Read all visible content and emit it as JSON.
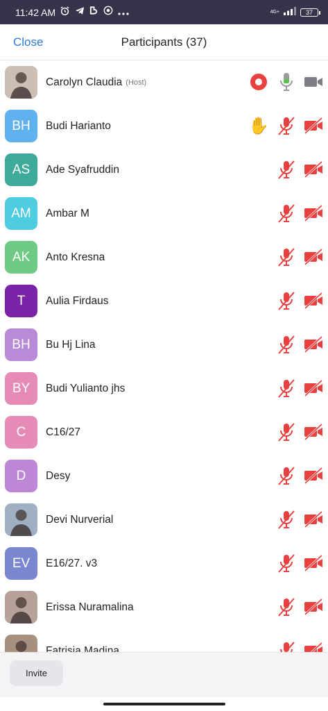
{
  "status_bar": {
    "time": "11:42 AM",
    "network": "4G+",
    "battery": "37",
    "icons": [
      "alarm-icon",
      "telegram-icon",
      "app-icon",
      "chrome-icon",
      "more-icon"
    ]
  },
  "header": {
    "close_label": "Close",
    "title": "Participants (37)"
  },
  "participants": [
    {
      "name": "Carolyn Claudia",
      "tag": "(Host)",
      "initials": "",
      "avatar_color": "#cdbfb4",
      "photo": true,
      "hand_raised": false,
      "recording": true,
      "mic_muted": false,
      "cam_off": true
    },
    {
      "name": "Budi Harianto",
      "tag": "",
      "initials": "BH",
      "avatar_color": "#5fb2ee",
      "photo": false,
      "hand_raised": true,
      "recording": false,
      "mic_muted": true,
      "cam_off": true
    },
    {
      "name": "Ade Syafruddin",
      "tag": "",
      "initials": "AS",
      "avatar_color": "#3daa9a",
      "photo": false,
      "hand_raised": false,
      "recording": false,
      "mic_muted": true,
      "cam_off": true
    },
    {
      "name": "Ambar M",
      "tag": "",
      "initials": "AM",
      "avatar_color": "#4ecde0",
      "photo": false,
      "hand_raised": false,
      "recording": false,
      "mic_muted": true,
      "cam_off": true
    },
    {
      "name": "Anto Kresna",
      "tag": "",
      "initials": "AK",
      "avatar_color": "#6fca86",
      "photo": false,
      "hand_raised": false,
      "recording": false,
      "mic_muted": true,
      "cam_off": true
    },
    {
      "name": "Aulia Firdaus",
      "tag": "",
      "initials": "T",
      "avatar_color": "#7a22a8",
      "photo": false,
      "hand_raised": false,
      "recording": false,
      "mic_muted": true,
      "cam_off": true
    },
    {
      "name": "Bu Hj Lina",
      "tag": "",
      "initials": "BH",
      "avatar_color": "#b98ad8",
      "photo": false,
      "hand_raised": false,
      "recording": false,
      "mic_muted": true,
      "cam_off": true
    },
    {
      "name": "Budi Yulianto jhs",
      "tag": "",
      "initials": "BY",
      "avatar_color": "#e68ab6",
      "photo": false,
      "hand_raised": false,
      "recording": false,
      "mic_muted": true,
      "cam_off": true
    },
    {
      "name": "C16/27",
      "tag": "",
      "initials": "C",
      "avatar_color": "#e68ab6",
      "photo": false,
      "hand_raised": false,
      "recording": false,
      "mic_muted": true,
      "cam_off": true
    },
    {
      "name": "Desy",
      "tag": "",
      "initials": "D",
      "avatar_color": "#be86d6",
      "photo": false,
      "hand_raised": false,
      "recording": false,
      "mic_muted": true,
      "cam_off": true
    },
    {
      "name": "Devi Nurverial",
      "tag": "",
      "initials": "",
      "avatar_color": "#9fb0c4",
      "photo": true,
      "hand_raised": false,
      "recording": false,
      "mic_muted": true,
      "cam_off": true
    },
    {
      "name": "E16/27.  v3",
      "tag": "",
      "initials": "EV",
      "avatar_color": "#7b86d0",
      "photo": false,
      "hand_raised": false,
      "recording": false,
      "mic_muted": true,
      "cam_off": true
    },
    {
      "name": "Erissa Nuramalina",
      "tag": "",
      "initials": "",
      "avatar_color": "#b7a29a",
      "photo": true,
      "hand_raised": false,
      "recording": false,
      "mic_muted": true,
      "cam_off": true
    },
    {
      "name": "Fatrisia Madina",
      "tag": "",
      "initials": "",
      "avatar_color": "#a89080",
      "photo": true,
      "hand_raised": false,
      "recording": false,
      "mic_muted": true,
      "cam_off": true
    }
  ],
  "footer": {
    "invite_label": "Invite"
  },
  "colors": {
    "accent": "#2d7ad6",
    "muted_red": "#e8403e",
    "active_mic": "#5cc44d",
    "cam_grey": "#7d7d85",
    "hand": "#f5c21c"
  }
}
